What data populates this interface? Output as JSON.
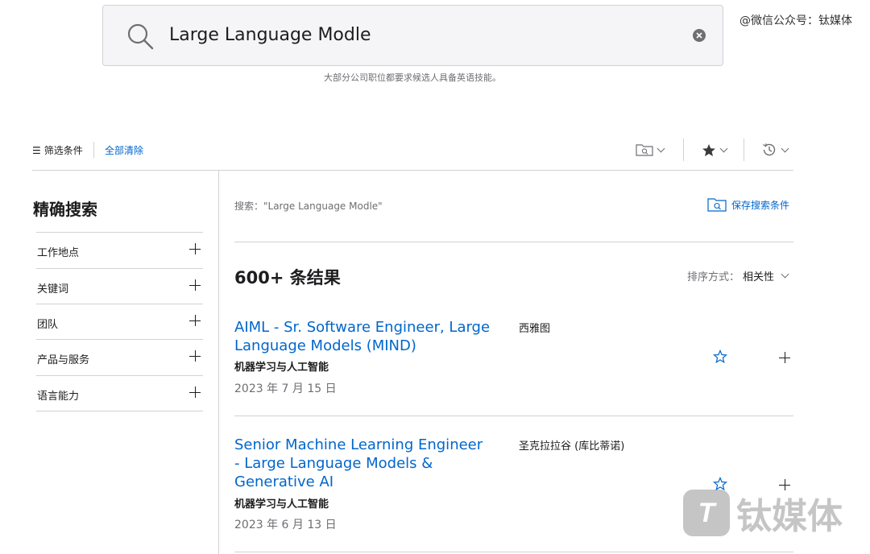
{
  "search": {
    "query": "Large Language Modle",
    "hint": "大部分公司职位都要求候选人具备英语技能。"
  },
  "watermark": {
    "top_text": "@微信公众号：钛媒体",
    "logo_text": "钛媒体",
    "logo_mark": "T"
  },
  "toolbar": {
    "filter_label": "筛选条件",
    "clear_all_label": "全部清除"
  },
  "sidebar": {
    "title": "精确搜索",
    "facets": [
      {
        "label": "工作地点"
      },
      {
        "label": "关键词"
      },
      {
        "label": "团队"
      },
      {
        "label": "产品与服务"
      },
      {
        "label": "语言能力"
      }
    ]
  },
  "main": {
    "query_echo": "搜索：\"Large Language Modle\"",
    "save_search_label": "保存搜索条件",
    "results_count": "600+ 条结果",
    "sort_key": "排序方式：",
    "sort_value": "相关性",
    "jobs": [
      {
        "title": "AIML - Sr. Software Engineer, Large Language Models (MIND)",
        "team": "机器学习与人工智能",
        "date": "2023 年 7 月 15 日",
        "location": "西雅图"
      },
      {
        "title": "Senior Machine Learning Engineer - Large Language Models & Generative AI",
        "team": "机器学习与人工智能",
        "date": "2023 年 6 月 13 日",
        "location": "圣克拉拉谷 (库比蒂诺)"
      }
    ]
  },
  "colors": {
    "link": "#0066cc",
    "text": "#1d1d1f",
    "muted": "#6e6e73",
    "border": "#d2d2d7"
  }
}
